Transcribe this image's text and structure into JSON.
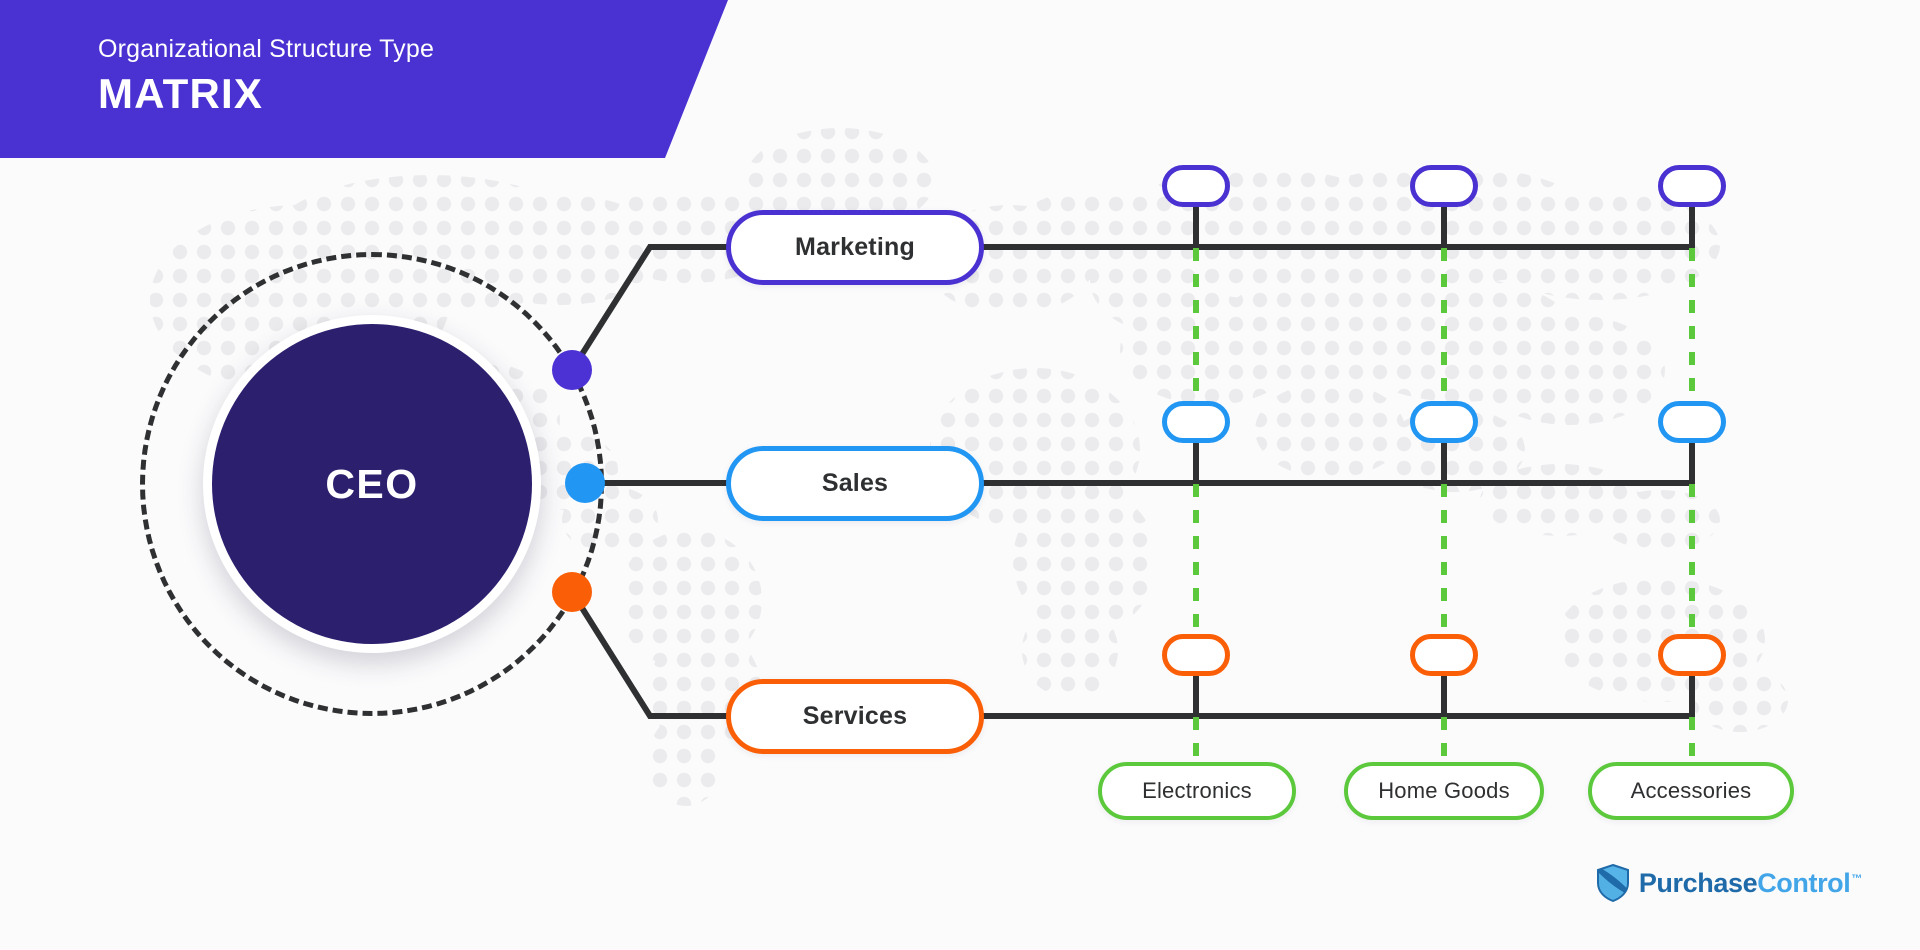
{
  "header": {
    "subtitle": "Organizational Structure Type",
    "title": "MATRIX",
    "banner_color": "#4a32d2"
  },
  "ceo": {
    "label": "CEO",
    "circle_color": "#2b1f6e",
    "ring_color": "#2f3032"
  },
  "departments": [
    {
      "label": "Marketing",
      "color": "#4a32d2",
      "dot_color": "#4c32d4"
    },
    {
      "label": "Sales",
      "color": "#2196f3",
      "dot_color": "#2196f3"
    },
    {
      "label": "Services",
      "color": "#fa5f07",
      "dot_color": "#fa5f07"
    }
  ],
  "products": [
    {
      "label": "Electronics",
      "color": "#5cc93c"
    },
    {
      "label": "Home Goods",
      "color": "#5cc93c"
    },
    {
      "label": "Accessories",
      "color": "#5cc93c"
    }
  ],
  "matrix_nodes": [
    {
      "row": "Marketing",
      "column": "Electronics",
      "label": "",
      "color": "#4a32d2"
    },
    {
      "row": "Marketing",
      "column": "Home Goods",
      "label": "",
      "color": "#4a32d2"
    },
    {
      "row": "Marketing",
      "column": "Accessories",
      "label": "",
      "color": "#4a32d2"
    },
    {
      "row": "Sales",
      "column": "Electronics",
      "label": "",
      "color": "#2196f3"
    },
    {
      "row": "Sales",
      "column": "Home Goods",
      "label": "",
      "color": "#2196f3"
    },
    {
      "row": "Sales",
      "column": "Accessories",
      "label": "",
      "color": "#2196f3"
    },
    {
      "row": "Services",
      "column": "Electronics",
      "label": "",
      "color": "#fa5f07"
    },
    {
      "row": "Services",
      "column": "Home Goods",
      "label": "",
      "color": "#fa5f07"
    },
    {
      "row": "Services",
      "column": "Accessories",
      "label": "",
      "color": "#fa5f07"
    }
  ],
  "connector_colors": {
    "line": "#2f3032",
    "dashed_vertical": "#5cc93c"
  },
  "logo": {
    "word_one": "Purchase",
    "word_two": "Control",
    "trademark": "™",
    "shield_dark": "#1f6aa8",
    "shield_light": "#56b4e8"
  }
}
